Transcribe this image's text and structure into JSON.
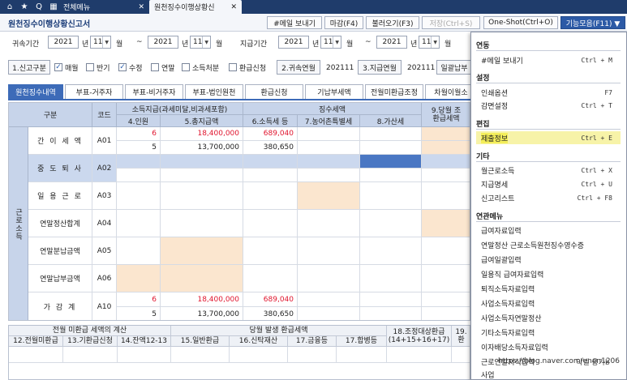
{
  "topbar": {
    "menu_label": "전체메뉴",
    "active_tab": "원천징수이행상황신"
  },
  "header": {
    "title": "원천징수이행상황신고서",
    "buttons": {
      "email": "#메일 보내기",
      "close": "마감(F4)",
      "load": "불러오기(F3)",
      "save": "저장(Ctrl+S)",
      "oneshot": "One-Shot(Ctrl+O)",
      "functions": "기능모음(F11) ▼"
    }
  },
  "period": {
    "attr_label": "귀속기간",
    "pay_label": "지급기간",
    "year_unit": "년",
    "month_unit": "월",
    "tilde": "~",
    "attr_from_year": "2021",
    "attr_from_month": "11",
    "attr_to_year": "2021",
    "attr_to_month": "11",
    "pay_from_year": "2021",
    "pay_from_month": "11",
    "pay_to_year": "2021",
    "pay_to_month": "11"
  },
  "filters": {
    "report_type_button": "1.신고구분",
    "monthly": "매월",
    "half": "반기",
    "revised": "수정",
    "yearend": "연말",
    "income_disposal": "소득처분",
    "refund_apply": "환급신청",
    "attr_ym_button": "2.귀속연월",
    "attr_ym_value": "202111",
    "pay_ym_button": "3.지급연월",
    "pay_ym_value": "202111",
    "bulk_button": "일괄납부"
  },
  "subtabs": [
    "원천징수내역",
    "부표-거주자",
    "부표-비거주자",
    "부표-법인원천",
    "환급신청",
    "기납부세액",
    "전월미환급조정",
    "차월이월소"
  ],
  "grid": {
    "header": {
      "division": "구분",
      "code": "코드",
      "income_pay_group": "소득지급(과세미달,비과세포함)",
      "tax_group": "징수세액",
      "col9_line1": "9.당월 조",
      "col9_line2": "환급세액",
      "col4": "4.인원",
      "col5": "5.총지급액",
      "col6": "6.소득세 등",
      "col7": "7.농어촌특별세",
      "col8": "8.가산세"
    },
    "side_label": "근로소득",
    "rows": [
      {
        "label": "간 이 세 액",
        "code": "A01",
        "col4": "6",
        "col5": "18,400,000",
        "col6": "689,040",
        "sub4": "5",
        "sub5": "13,700,000",
        "sub6": "380,650"
      },
      {
        "label": "중 도 퇴 사",
        "code": "A02"
      },
      {
        "label": "일 용 근 로",
        "code": "A03"
      },
      {
        "label": "연말정산합계",
        "code": "A04"
      },
      {
        "label": "연말분납금액",
        "code": "A05"
      },
      {
        "label": "연말납부금액",
        "code": "A06"
      },
      {
        "label": "가 감 계",
        "code": "A10",
        "col4": "6",
        "col5": "18,400,000",
        "col6": "689,040",
        "sub4": "5",
        "sub5": "13,700,000",
        "sub6": "380,650"
      }
    ]
  },
  "bottom": {
    "group1": "전월 미환급 세액의 계산",
    "group2": "당월 발생 환급세액",
    "col18_line1": "18.조정대상환급",
    "col18_line2": "(14+15+16+17)",
    "col19_line1": "19.",
    "col19_line2": "환",
    "col12": "12.전월미환급",
    "col13": "13.기환급신청",
    "col14": "14.잔액12-13",
    "col15": "15.일반환급",
    "col16": "16.신탁재산",
    "col17a": "17.금융등",
    "col17b": "17.합병등"
  },
  "menu": {
    "sections": [
      {
        "head": "연동",
        "items": [
          {
            "label": "#메일 보내기",
            "shortcut": "Ctrl + M"
          }
        ]
      },
      {
        "head": "설정",
        "items": [
          {
            "label": "인쇄옵션",
            "shortcut": "F7"
          },
          {
            "label": "감면설정",
            "shortcut": "Ctrl + T"
          }
        ]
      },
      {
        "head": "편집",
        "items": [
          {
            "label": "제출정보",
            "shortcut": "Ctrl + E"
          }
        ]
      },
      {
        "head": "기타",
        "items": [
          {
            "label": "월근로소득",
            "shortcut": "Ctrl + X"
          },
          {
            "label": "지급명세",
            "shortcut": "Ctrl + U"
          },
          {
            "label": "신고리스트",
            "shortcut": "Ctrl + F8"
          }
        ]
      },
      {
        "head": "연관메뉴",
        "items": [
          {
            "label": "급여자료입력"
          },
          {
            "label": "연말정산 근로소득원천징수영수증"
          },
          {
            "label": "급여일괄입력"
          },
          {
            "label": "일용직 급여자료입력"
          },
          {
            "label": "퇴직소득자료입력"
          },
          {
            "label": "사업소득자료입력"
          },
          {
            "label": "사업소득자연말정산"
          },
          {
            "label": "기타소득자료입력"
          },
          {
            "label": "이자배당소득자료입력"
          },
          {
            "label": "근로연말저식입력"
          },
          {
            "label": "사업"
          }
        ]
      }
    ]
  },
  "watermark": {
    "url": "https://blog.naver.com/enen1206",
    "sign": "악넬 용가b"
  }
}
